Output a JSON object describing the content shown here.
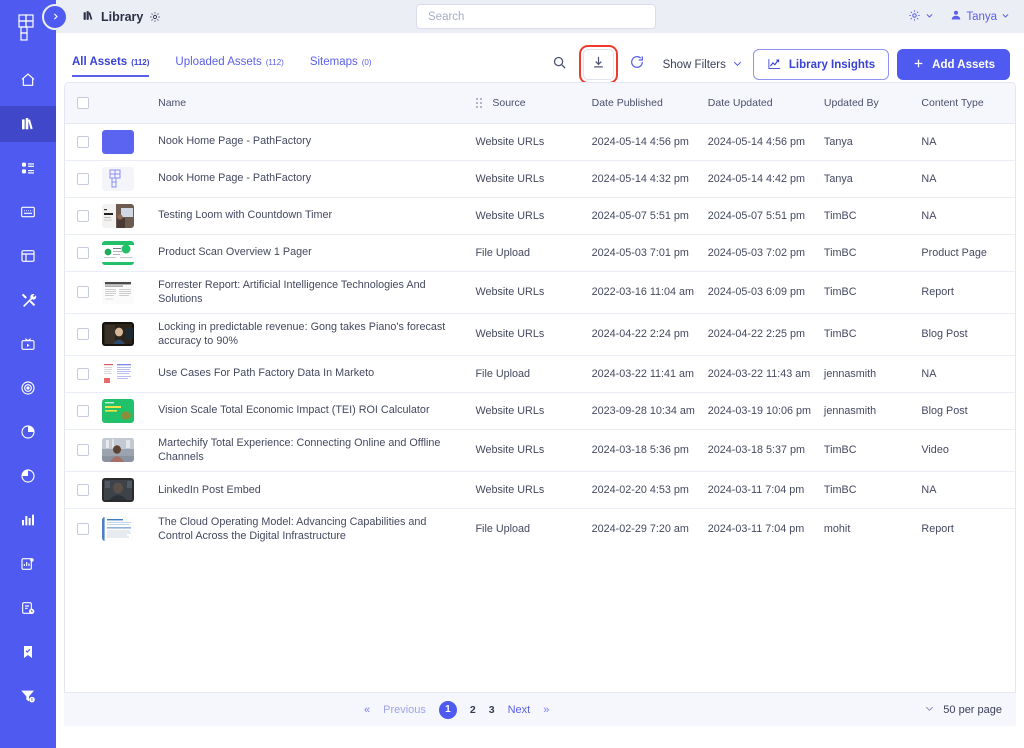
{
  "colors": {
    "brand": "#4f5bf0",
    "brand_dark": "#4048c9",
    "topbar_bg": "#eceef6",
    "accent_link": "#5b61e8",
    "highlight_outline": "#ef3b2d",
    "table_header_bg": "#f6f7fd"
  },
  "topbar": {
    "title": "Library",
    "gear_icon": "gear-icon",
    "logo_icon": "pathfactory-logo-icon",
    "expand_icon": "chevron-right-icon",
    "search": {
      "value": "",
      "placeholder": "Search"
    },
    "settings_menu_label": "",
    "settings_icon": "gear-icon",
    "user_name": "Tanya",
    "user_icon": "user-icon",
    "caret_icon": "chevron-down-icon"
  },
  "sidebar": {
    "items": [
      {
        "icon": "home-icon",
        "active": false
      },
      {
        "icon": "library-books-icon",
        "active": true
      },
      {
        "icon": "content-blocks-icon",
        "active": false
      },
      {
        "icon": "keyboard-icon",
        "active": false
      },
      {
        "icon": "window-layout-icon",
        "active": false
      },
      {
        "icon": "tools-icon",
        "active": false
      },
      {
        "icon": "video-player-icon",
        "active": false
      },
      {
        "icon": "target-icon",
        "active": false
      },
      {
        "icon": "pie-chart-icon",
        "active": false
      },
      {
        "icon": "pie-chart-alt-icon",
        "active": false
      },
      {
        "icon": "bar-chart-icon",
        "active": false
      },
      {
        "icon": "report-add-icon",
        "active": false
      },
      {
        "icon": "clipboard-clock-icon",
        "active": false
      },
      {
        "icon": "bookmark-check-icon",
        "active": false
      },
      {
        "icon": "funnel-dollar-icon",
        "active": false
      }
    ]
  },
  "tabs": [
    {
      "label": "All Assets",
      "count": "(112)",
      "active": true
    },
    {
      "label": "Uploaded Assets",
      "count": "(112)",
      "active": false
    },
    {
      "label": "Sitemaps",
      "count": "(0)",
      "active": false
    }
  ],
  "toolbar": {
    "search_icon": "search-icon",
    "download_icon": "download-icon",
    "refresh_icon": "refresh-icon",
    "show_filters_label": "Show Filters",
    "show_filters_caret": "chevron-down-icon",
    "library_insights_label": "Library Insights",
    "library_insights_icon": "line-chart-icon",
    "add_assets_label": "Add Assets",
    "add_assets_icon": "plus-icon",
    "highlighted_button": "download-icon"
  },
  "table": {
    "columns": [
      {
        "key": "name",
        "label": "Name"
      },
      {
        "key": "source",
        "label": "Source",
        "drag_icon": "drag-dots-icon"
      },
      {
        "key": "date_published",
        "label": "Date Published"
      },
      {
        "key": "date_updated",
        "label": "Date Updated"
      },
      {
        "key": "updated_by",
        "label": "Updated By"
      },
      {
        "key": "content_type",
        "label": "Content Type"
      }
    ],
    "rows": [
      {
        "name": "Nook Home Page - PathFactory",
        "thumb": "solid-purple",
        "source": "Website URLs",
        "date_published": "2024-05-14 4:56 pm",
        "date_updated": "2024-05-14 4:56 pm",
        "updated_by": "Tanya",
        "content_type": "NA"
      },
      {
        "name": "Nook Home Page - PathFactory",
        "thumb": "pathfactory-logo",
        "source": "Website URLs",
        "date_published": "2024-05-14 4:32 pm",
        "date_updated": "2024-05-14 4:42 pm",
        "updated_by": "Tanya",
        "content_type": "NA"
      },
      {
        "name": "Testing Loom with Countdown Timer",
        "thumb": "doc-photo-split",
        "source": "Website URLs",
        "date_published": "2024-05-07 5:51 pm",
        "date_updated": "2024-05-07 5:51 pm",
        "updated_by": "TimBC",
        "content_type": "NA"
      },
      {
        "name": "Product Scan Overview 1 Pager",
        "thumb": "green-onepager",
        "source": "File Upload",
        "date_published": "2024-05-03 7:01 pm",
        "date_updated": "2024-05-03 7:02 pm",
        "updated_by": "TimBC",
        "content_type": "Product Page"
      },
      {
        "name": "Forrester Report: Artificial Intelligence Technologies And Solutions",
        "thumb": "gray-report",
        "source": "Website URLs",
        "date_published": "2022-03-16 11:04 am",
        "date_updated": "2024-05-03 6:09 pm",
        "updated_by": "TimBC",
        "content_type": "Report"
      },
      {
        "name": "Locking in predictable revenue: Gong takes Piano's forecast accuracy to 90%",
        "thumb": "dark-video",
        "source": "Website URLs",
        "date_published": "2024-04-22 2:24 pm",
        "date_updated": "2024-04-22 2:25 pm",
        "updated_by": "TimBC",
        "content_type": "Blog Post"
      },
      {
        "name": "Use Cases For Path Factory Data In Marketo",
        "thumb": "light-doc-columns",
        "source": "File Upload",
        "date_published": "2024-03-22 11:41 am",
        "date_updated": "2024-03-22 11:43 am",
        "updated_by": "jennasmith",
        "content_type": "NA"
      },
      {
        "name": "Vision Scale Total Economic Impact (TEI) ROI Calculator",
        "thumb": "green-card",
        "source": "Website URLs",
        "date_published": "2023-09-28 10:34 am",
        "date_updated": "2024-03-19 10:06 pm",
        "updated_by": "jennasmith",
        "content_type": "Blog Post"
      },
      {
        "name": "Martechify Total Experience: Connecting Online and Offline Channels",
        "thumb": "person-photo",
        "source": "Website URLs",
        "date_published": "2024-03-18 5:36 pm",
        "date_updated": "2024-03-18 5:37 pm",
        "updated_by": "TimBC",
        "content_type": "Video"
      },
      {
        "name": "LinkedIn Post Embed",
        "thumb": "dark-photo",
        "source": "Website URLs",
        "date_published": "2024-02-20 4:53 pm",
        "date_updated": "2024-03-11 7:04 pm",
        "updated_by": "TimBC",
        "content_type": "NA"
      },
      {
        "name": "The Cloud Operating Model: Advancing Capabilities and Control Across the Digital Infrastructure",
        "thumb": "blue-doc",
        "source": "File Upload",
        "date_published": "2024-02-29 7:20 am",
        "date_updated": "2024-03-11 7:04 pm",
        "updated_by": "mohit",
        "content_type": "Report"
      }
    ]
  },
  "pagination": {
    "first_icon": "double-chevron-left-icon",
    "previous_label": "Previous",
    "pages": [
      "1",
      "2",
      "3"
    ],
    "current_page": "1",
    "next_label": "Next",
    "last_icon": "double-chevron-right-icon",
    "per_page_label": "50 per page",
    "per_page_caret": "chevron-down-icon"
  }
}
